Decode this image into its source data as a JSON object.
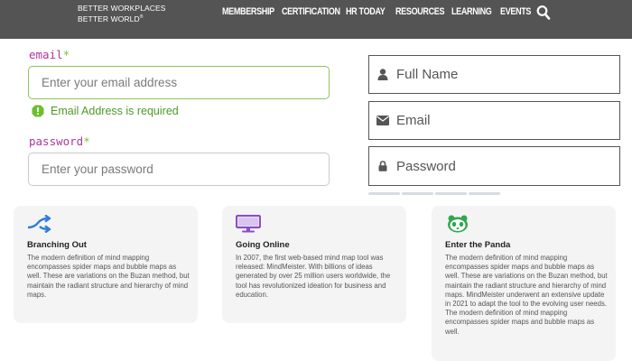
{
  "header": {
    "logo_line1": "BETTER WORKPLACES",
    "logo_line2": "BETTER WORLD",
    "logo_mark": "®",
    "nav": [
      "MEMBERSHIP",
      "CERTIFICATION",
      "HR TODAY",
      "RESOURCES",
      "LEARNING",
      "EVENTS"
    ],
    "search_icon": "search-icon"
  },
  "left_form": {
    "email_label": "email",
    "email_placeholder": "Enter your email address",
    "email_error": "Email Address is required",
    "password_label": "password",
    "password_placeholder": "Enter your password",
    "required_mark": "*",
    "colors": {
      "label": "#b0359b",
      "required": "#7ac143",
      "error": "#4d9a26",
      "focus_border": "#8cc55b"
    }
  },
  "right_form": {
    "name_placeholder": "Full Name",
    "email_placeholder": "Email",
    "password_placeholder": "Password",
    "icons": [
      "user-icon",
      "envelope-icon",
      "lock-icon"
    ]
  },
  "cards": [
    {
      "icon": "branch-arrows-icon",
      "title": "Branching Out",
      "body": "The modern definition of mind mapping encompasses spider maps and bubble maps as well. These are variations on the Buzan method, but maintain the radiant structure and hierarchy of mind maps."
    },
    {
      "icon": "monitor-icon",
      "title": "Going Online",
      "body": "In 2007, the first web-based mind map tool was released: MindMeister. With billions of ideas generated by over 25 million users worldwide, the tool has revolutionized ideation for business and education."
    },
    {
      "icon": "panda-icon",
      "title": "Enter the Panda",
      "body": "The modern definition of mind mapping encompasses spider maps and bubble maps as well. These are variations on the Buzan method, but maintain the radiant structure and hierarchy of mind maps. MindMeister underwent an extensive update in 2021 to adapt the tool to the evolving user needs. The modern definition of mind mapping encompasses spider maps and bubble maps as well."
    }
  ],
  "icon_colors": {
    "branch": "#2f7fd6",
    "monitor": "#8a4fc7",
    "panda": "#2fa84f"
  }
}
